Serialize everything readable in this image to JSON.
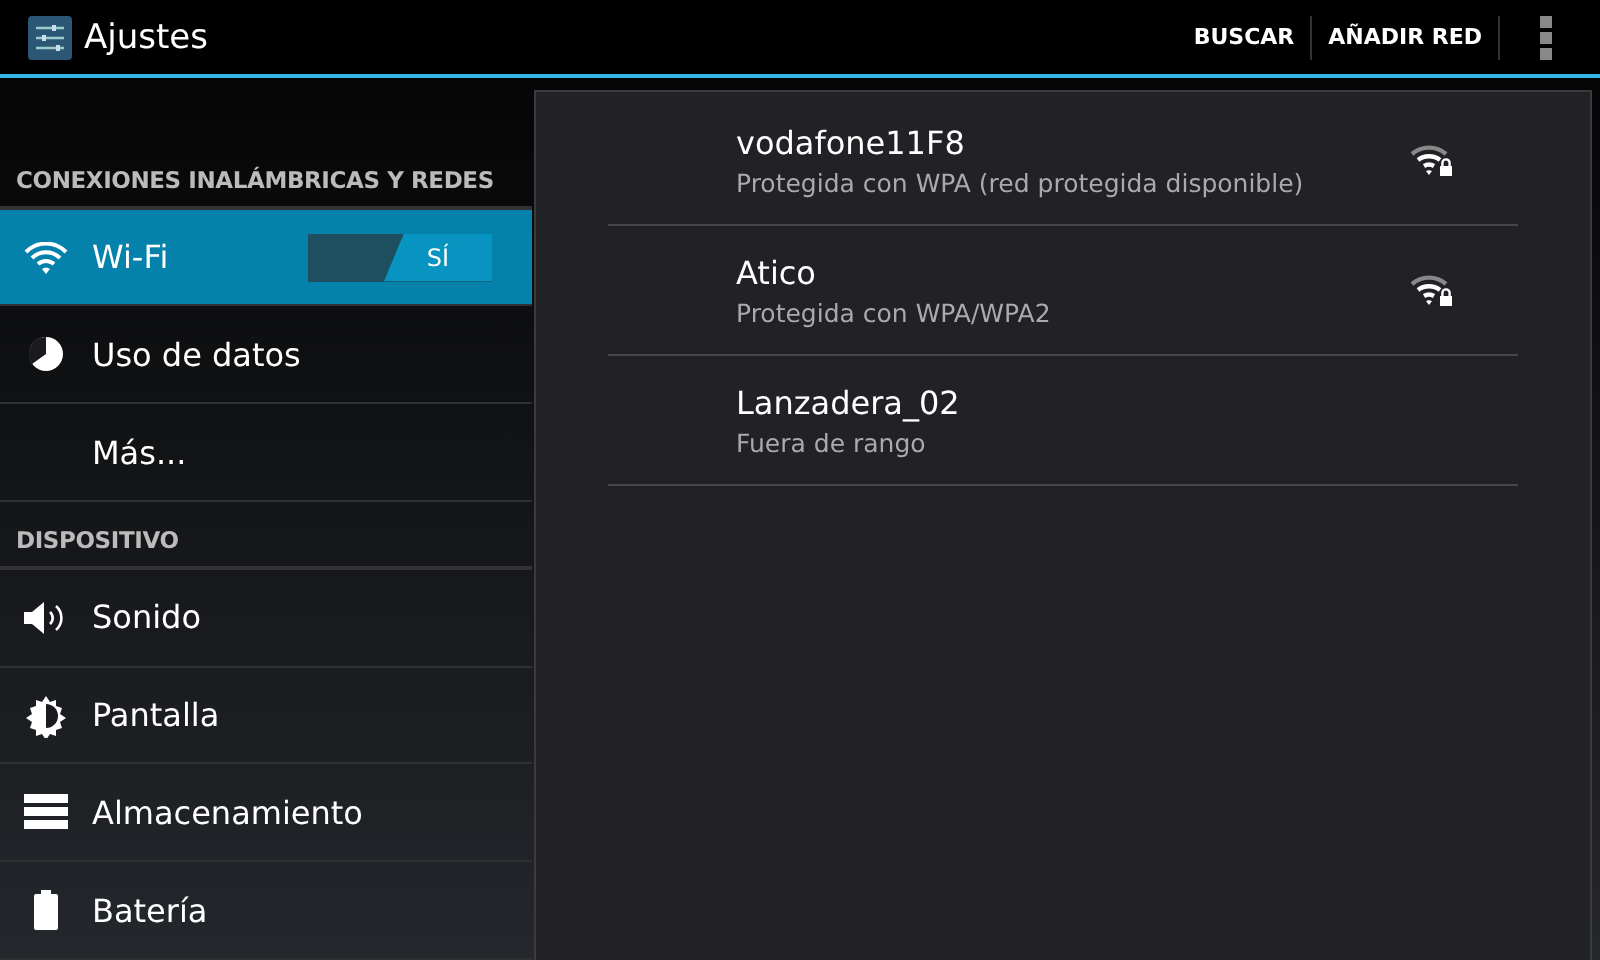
{
  "action_bar": {
    "title": "Ajustes",
    "actions": [
      "BUSCAR",
      "AÑADIR RED"
    ]
  },
  "sidebar": {
    "items": [
      {
        "kind": "header",
        "label": "CONEXIONES INALÁMBRICAS Y REDES",
        "first": true
      },
      {
        "kind": "wifi",
        "label": "Wi-Fi",
        "selected": true,
        "switch": {
          "label": "SÍ",
          "on": true
        }
      },
      {
        "kind": "data",
        "label": "Uso de datos",
        "selected": false
      },
      {
        "kind": "plain",
        "label": "Más...",
        "selected": false
      },
      {
        "kind": "header",
        "label": "DISPOSITIVO",
        "first": false
      },
      {
        "kind": "sound",
        "label": "Sonido",
        "selected": false
      },
      {
        "kind": "display",
        "label": "Pantalla",
        "selected": false
      },
      {
        "kind": "storage",
        "label": "Almacenamiento",
        "selected": false
      },
      {
        "kind": "battery",
        "label": "Batería",
        "selected": false
      }
    ]
  },
  "networks": [
    {
      "name": "vodafone11F8",
      "status": "Protegida con WPA (red protegida disponible)",
      "in_range": true
    },
    {
      "name": "Atico",
      "status": "Protegida con WPA/WPA2",
      "in_range": true
    },
    {
      "name": "Lanzadera_02",
      "status": "Fuera de rango",
      "in_range": false
    }
  ]
}
